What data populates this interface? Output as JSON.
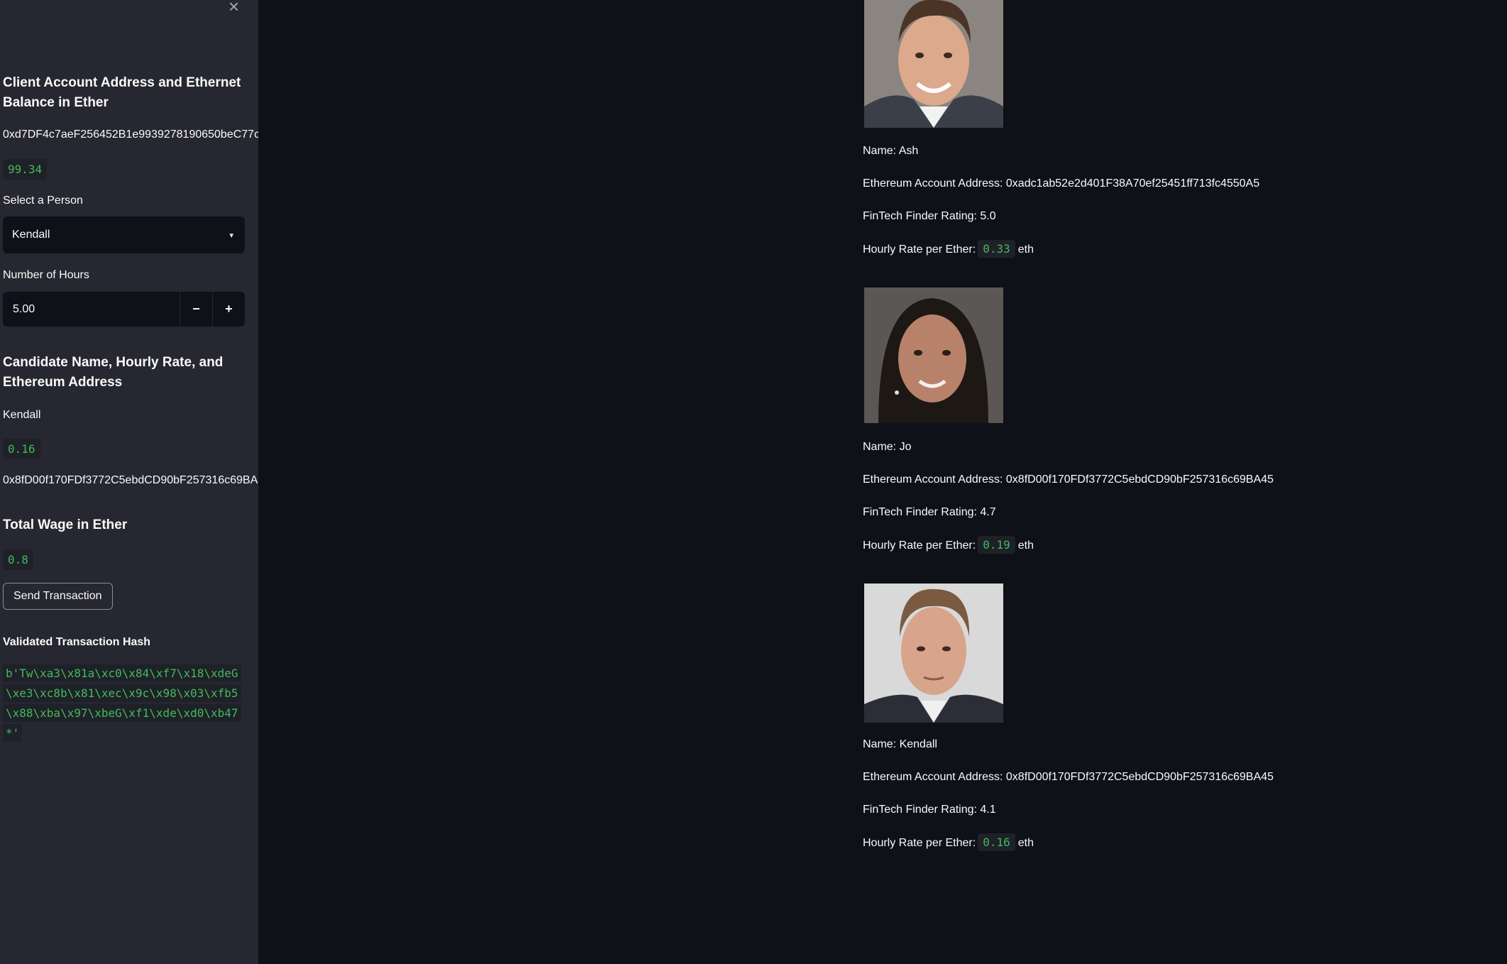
{
  "sidebar": {
    "client_heading": "Client Account Address and Ethernet Balance in Ether",
    "client_address": "0xd7DF4c7aeF256452B1e9939278190650beC77c",
    "client_balance": "99.34",
    "select_label": "Select a Person",
    "selected_person": "Kendall",
    "hours_label": "Number of Hours",
    "hours_value": "5.00",
    "minus_label": "−",
    "plus_label": "+",
    "candidate_heading": "Candidate Name, Hourly Rate, and Ethereum Address",
    "candidate_name": "Kendall",
    "candidate_rate": "0.16",
    "candidate_address": "0x8fD00f170FDf3772C5ebdCD90bF257316c69BA",
    "total_heading": "Total Wage in Ether",
    "total_wage": "0.8",
    "send_button": "Send Transaction",
    "hash_label": "Validated Transaction Hash",
    "hash_value": "b'Tw\\xa3\\x81a\\xc0\\x84\\xf7\\x18\\xdeG\\xe3\\xc8b\\x81\\xec\\x9c\\x98\\x03\\xfb5\\x88\\xba\\x97\\xbeG\\xf1\\xde\\xd0\\xb47*'"
  },
  "candidates": [
    {
      "name": "Name: Ash",
      "address": "Ethereum Account Address: 0xadc1ab52e2d401F38A70ef25451ff713fc4550A5",
      "rating": "FinTech Finder Rating: 5.0",
      "rate_label": "Hourly Rate per Ether:",
      "rate": "0.33",
      "unit": "eth"
    },
    {
      "name": "Name: Jo",
      "address": "Ethereum Account Address: 0x8fD00f170FDf3772C5ebdCD90bF257316c69BA45",
      "rating": "FinTech Finder Rating: 4.7",
      "rate_label": "Hourly Rate per Ether:",
      "rate": "0.19",
      "unit": "eth"
    },
    {
      "name": "Name: Kendall",
      "address": "Ethereum Account Address: 0x8fD00f170FDf3772C5ebdCD90bF257316c69BA45",
      "rating": "FinTech Finder Rating: 4.1",
      "rate_label": "Hourly Rate per Ether:",
      "rate": "0.16",
      "unit": "eth"
    }
  ]
}
